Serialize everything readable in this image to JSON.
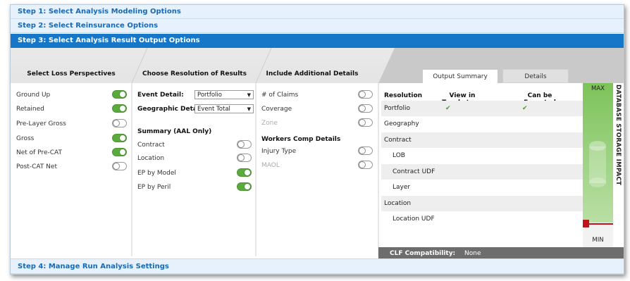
{
  "steps": {
    "step1": "Step 1: Select Analysis Modeling Options",
    "step2": "Step 2: Select Reinsurance Options",
    "step3": "Step 3: Select Analysis Result Output Options",
    "step4": "Step 4: Manage Run Analysis Settings"
  },
  "loss_perspectives": {
    "heading": "Select Loss Perspectives",
    "items": [
      {
        "label": "Ground Up",
        "on": true
      },
      {
        "label": "Retained",
        "on": true
      },
      {
        "label": "Pre-Layer Gross",
        "on": false
      },
      {
        "label": "Gross",
        "on": true
      },
      {
        "label": "Net of Pre-CAT",
        "on": true
      },
      {
        "label": "Post-CAT Net",
        "on": false
      }
    ]
  },
  "resolution": {
    "heading": "Choose Resolution of Results",
    "event_detail_label": "Event Detail:",
    "event_detail_value": "Portfolio",
    "geographic_detail_label": "Geographic Detail:",
    "geographic_detail_value": "Event Total",
    "summary_heading": "Summary (AAL Only)",
    "summary_items": [
      {
        "label": "Contract",
        "on": false
      },
      {
        "label": "Location",
        "on": false
      },
      {
        "label": "EP by Model",
        "on": true
      },
      {
        "label": "EP by Peril",
        "on": true
      }
    ]
  },
  "additional": {
    "heading": "Include Additional Details",
    "items": [
      {
        "label": "# of Claims",
        "on": false,
        "disabled": false
      },
      {
        "label": "Coverage",
        "on": false,
        "disabled": false
      },
      {
        "label": "Zone",
        "on": false,
        "disabled": true
      }
    ],
    "workers_heading": "Workers Comp Details",
    "workers_items": [
      {
        "label": "Injury Type",
        "on": false,
        "disabled": false
      },
      {
        "label": "MAOL",
        "on": false,
        "disabled": true
      }
    ]
  },
  "output": {
    "tabs": [
      "Output Summary",
      "Details"
    ],
    "columns": [
      "Resolution",
      "View in Touchstone",
      "Can be Exported"
    ],
    "rows": [
      {
        "label": "Portfolio",
        "touchstone": true,
        "exported": true
      },
      {
        "label": "Geography",
        "touchstone": false,
        "exported": false
      },
      {
        "label": "Contract",
        "touchstone": false,
        "exported": false
      },
      {
        "label": "LOB",
        "touchstone": false,
        "exported": false
      },
      {
        "label": "Contract UDF",
        "touchstone": false,
        "exported": false
      },
      {
        "label": "Layer",
        "touchstone": false,
        "exported": false
      },
      {
        "label": "Location",
        "touchstone": false,
        "exported": false
      },
      {
        "label": "Location UDF",
        "touchstone": false,
        "exported": false
      }
    ],
    "gauge": {
      "max_label": "MAX",
      "min_label": "MIN",
      "title": "DATABASE STORAGE IMPACT",
      "level": 0.08
    },
    "clf_label": "CLF Compatibility:",
    "clf_value": "None"
  },
  "colors": {
    "accent": "#1676c8",
    "toggle_on": "#5aaa3c",
    "gauge_green": "#7dc35a",
    "gauge_marker": "#c0121a"
  }
}
